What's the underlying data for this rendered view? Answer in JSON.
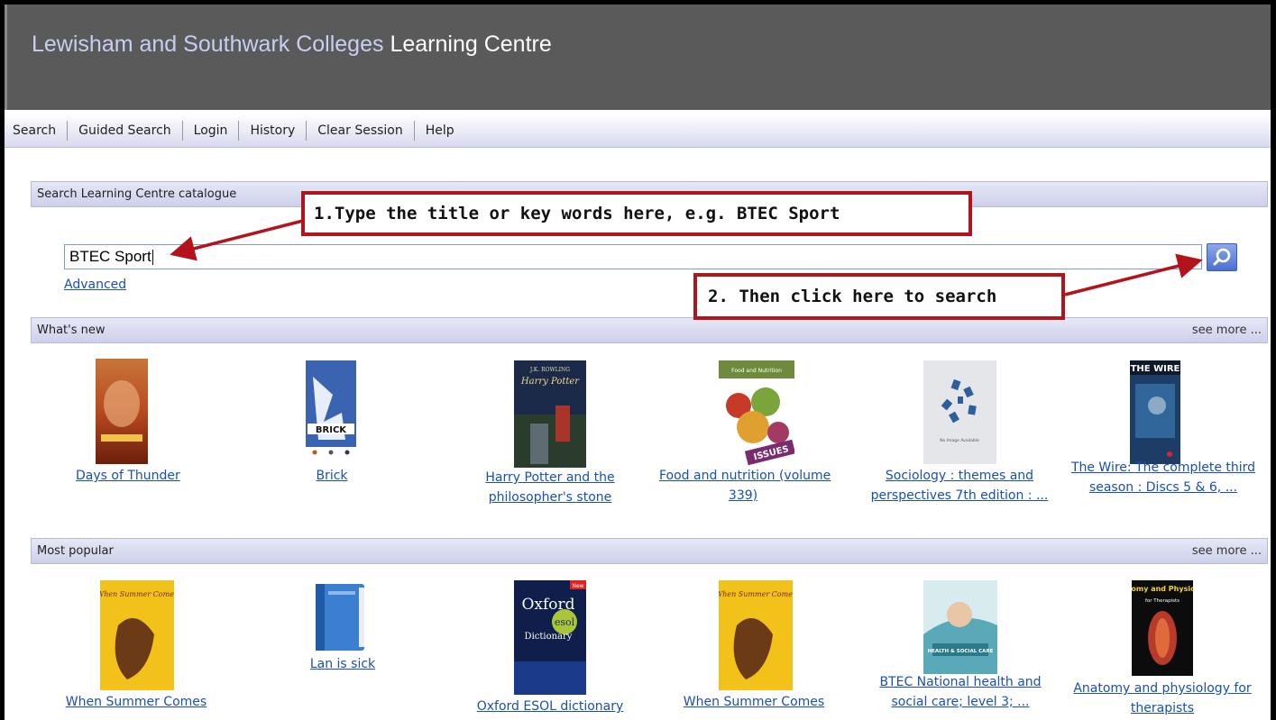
{
  "header": {
    "title_prefix": "Lewisham and Southwark Colleges",
    "title_suffix": "Learning Centre"
  },
  "nav": [
    "Search",
    "Guided Search",
    "Login",
    "History",
    "Clear Session",
    "Help"
  ],
  "search_panel": {
    "title": "Search Learning Centre catalogue",
    "input_value": "BTEC Sport",
    "advanced_label": "Advanced"
  },
  "callouts": {
    "step1": "1.Type the title or key words here, e.g. BTEC Sport",
    "step2": "2. Then click here to search"
  },
  "whats_new": {
    "title": "What's new",
    "more": "see more ...",
    "items": [
      {
        "lines": [
          "Days of Thunder"
        ]
      },
      {
        "lines": [
          "Brick"
        ]
      },
      {
        "lines": [
          "Harry Potter and the",
          "philosopher's stone"
        ]
      },
      {
        "lines": [
          "Food and nutrition (volume",
          "339)"
        ]
      },
      {
        "lines": [
          "Sociology : themes and",
          "perspectives 7th edition : ..."
        ]
      },
      {
        "lines": [
          "The Wire: The complete third",
          "season : Discs 5 & 6, ..."
        ]
      }
    ],
    "cover_texts": {
      "brick": "BRICK",
      "harry_author": "J.K. ROWLING",
      "harry_title": "Harry Potter",
      "food_title": "Food and Nutrition",
      "food_issues": "ISSUES",
      "no_image": "No Image Available",
      "wire": "THE WIRE"
    }
  },
  "most_popular": {
    "title": "Most popular",
    "more": "see more ...",
    "items": [
      {
        "lines": [
          "When Summer Comes"
        ]
      },
      {
        "lines": [
          "Lan is sick"
        ]
      },
      {
        "lines": [
          "Oxford ESOL dictionary"
        ]
      },
      {
        "lines": [
          "When Summer Comes"
        ]
      },
      {
        "lines": [
          "BTEC National health and",
          "social care; level 3; ..."
        ]
      },
      {
        "lines": [
          "Anatomy and physiology for",
          "therapists"
        ]
      }
    ],
    "cover_texts": {
      "summer": "When Summer Comes",
      "oxford": "Oxford",
      "esol": "esol",
      "dictionary": "Dictionary",
      "new_badge": "New",
      "health": "HEALTH & SOCIAL CARE",
      "anatomy": "Anatomy and Physiology",
      "anatomy_sub": "for Therapists"
    }
  },
  "colors": {
    "callout": "#b3141b",
    "link": "#1a4fb5",
    "header": "#5a5a5a"
  }
}
